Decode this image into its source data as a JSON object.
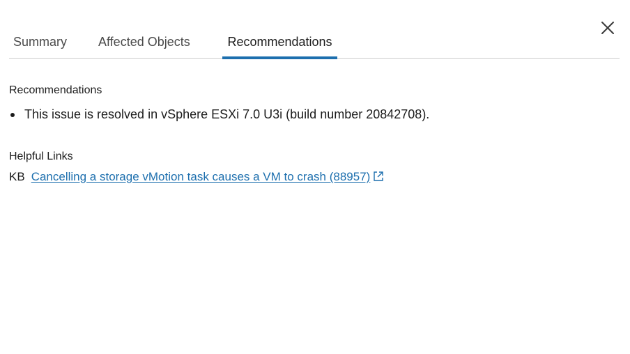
{
  "tabs": [
    {
      "label": "Summary",
      "active": false
    },
    {
      "label": "Affected Objects",
      "active": false
    },
    {
      "label": "Recommendations",
      "active": true
    }
  ],
  "close": {
    "icon": "close-icon"
  },
  "recommendations": {
    "title": "Recommendations",
    "items": [
      "This issue is resolved in vSphere ESXi 7.0 U3i (build number 20842708)."
    ]
  },
  "helpful_links": {
    "title": "Helpful Links",
    "links": [
      {
        "prefix": "KB",
        "text": "Cancelling a storage vMotion task causes a VM to crash (88957)",
        "icon": "external-link-icon"
      }
    ]
  },
  "colors": {
    "accent": "#1d6fae",
    "text": "#1c1c1c",
    "divider": "#cccccc"
  }
}
